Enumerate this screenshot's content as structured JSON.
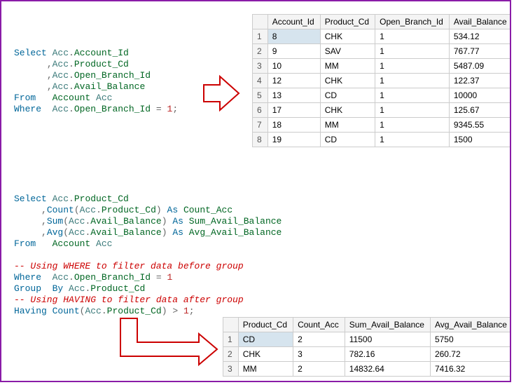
{
  "query1": {
    "select": "Select",
    "acc_account_id_a": "Acc",
    "dot1": ".",
    "acc_account_id_b": "Account_Id",
    "line2a": "Acc",
    "line2b": "Product_Cd",
    "line3a": "Acc",
    "line3b": "Open_Branch_Id",
    "line4a": "Acc",
    "line4b": "Avail_Balance",
    "from": "From",
    "account": "Account",
    "accAlias": "Acc",
    "where": "Where",
    "where_l": "Acc",
    "where_r": "Open_Branch_Id",
    "eq": "=",
    "one": "1",
    "semi": ";",
    "comma": ","
  },
  "table1": {
    "headers": [
      "",
      "Account_Id",
      "Product_Cd",
      "Open_Branch_Id",
      "Avail_Balance"
    ],
    "rows": [
      [
        "1",
        "8",
        "CHK",
        "1",
        "534.12"
      ],
      [
        "2",
        "9",
        "SAV",
        "1",
        "767.77"
      ],
      [
        "3",
        "10",
        "MM",
        "1",
        "5487.09"
      ],
      [
        "4",
        "12",
        "CHK",
        "1",
        "122.37"
      ],
      [
        "5",
        "13",
        "CD",
        "1",
        "10000"
      ],
      [
        "6",
        "17",
        "CHK",
        "1",
        "125.67"
      ],
      [
        "7",
        "18",
        "MM",
        "1",
        "9345.55"
      ],
      [
        "8",
        "19",
        "CD",
        "1",
        "1500"
      ]
    ],
    "selectedCell": [
      0,
      1
    ]
  },
  "query2": {
    "select": "Select",
    "l1a": "Acc",
    "l1b": "Product_Cd",
    "count": "Count",
    "as": "As",
    "countAlias": "Count_Acc",
    "sum": "Sum",
    "sumAlias": "Sum_Avail_Balance",
    "avg": "Avg",
    "avgAlias": "Avg_Avail_Balance",
    "from": "From",
    "account": "Account",
    "accAlias": "Acc",
    "comment1": "-- Using WHERE to filter data before group",
    "where": "Where",
    "where_l": "Acc",
    "where_r": "Open_Branch_Id",
    "one": "1",
    "group": "Group",
    "by": "By",
    "gb_l": "Acc",
    "gb_r": "Product_Cd",
    "comment2": "-- Using HAVING to filter data after group",
    "having": "Having",
    "hv_one": "1",
    "availBal": "Avail_Balance"
  },
  "table2": {
    "headers": [
      "",
      "Product_Cd",
      "Count_Acc",
      "Sum_Avail_Balance",
      "Avg_Avail_Balance"
    ],
    "rows": [
      [
        "1",
        "CD",
        "2",
        "11500",
        "5750"
      ],
      [
        "2",
        "CHK",
        "3",
        "782.16",
        "260.72"
      ],
      [
        "3",
        "MM",
        "2",
        "14832.64",
        "7416.32"
      ]
    ],
    "selectedCell": [
      0,
      1
    ]
  }
}
